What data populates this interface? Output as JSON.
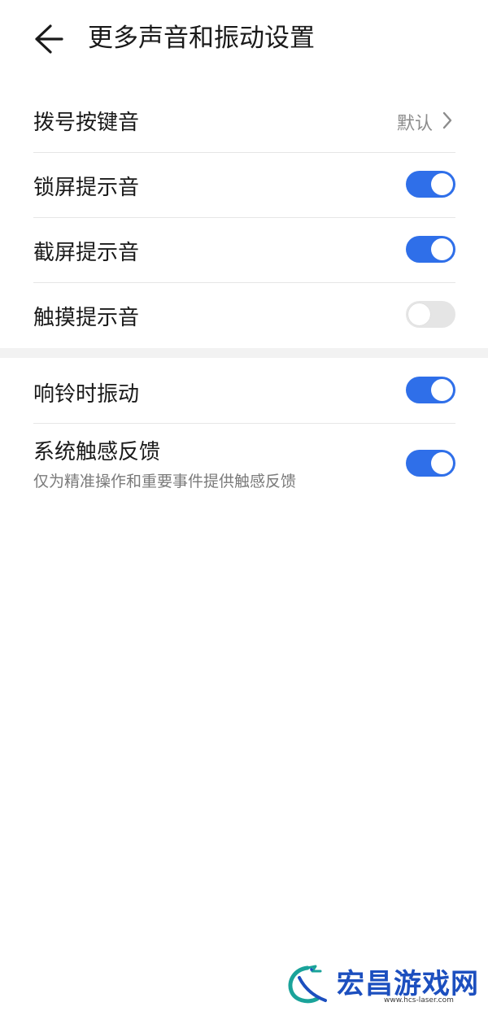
{
  "header": {
    "title": "更多声音和振动设置",
    "back_icon": "arrow-left-icon"
  },
  "sound_section": {
    "items": [
      {
        "label": "拨号按键音",
        "value": "默认",
        "control": "chevron"
      },
      {
        "label": "锁屏提示音",
        "control": "toggle",
        "on": true
      },
      {
        "label": "截屏提示音",
        "control": "toggle",
        "on": true
      },
      {
        "label": "触摸提示音",
        "control": "toggle",
        "on": false
      }
    ]
  },
  "vibration_section": {
    "items": [
      {
        "label": "响铃时振动",
        "control": "toggle",
        "on": true
      },
      {
        "label": "系统触感反馈",
        "subtitle": "仅为精准操作和重要事件提供触感反馈",
        "control": "toggle",
        "on": true
      }
    ]
  },
  "watermark": {
    "text": "宏昌游戏网",
    "subtext": "www.hcs-laser.com"
  },
  "colors": {
    "accent": "#2f6fe9",
    "toggle_off": "#e5e5e5",
    "section_gap": "#f2f2f2",
    "watermark": "#1c4fbf"
  }
}
